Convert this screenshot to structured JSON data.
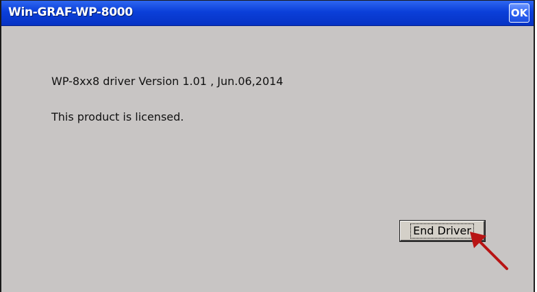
{
  "window": {
    "title": "Win-GRAF-WP-8000",
    "ok_label": "OK"
  },
  "content": {
    "version_line": "WP-8xx8 driver Version 1.01 , Jun.06,2014",
    "license_line": "This product is licensed."
  },
  "actions": {
    "end_driver_label": "End Driver"
  },
  "colors": {
    "titlebar": "#0b3fd9",
    "dialog_background": "#c8c5c4",
    "annotation_arrow": "#b81414"
  }
}
